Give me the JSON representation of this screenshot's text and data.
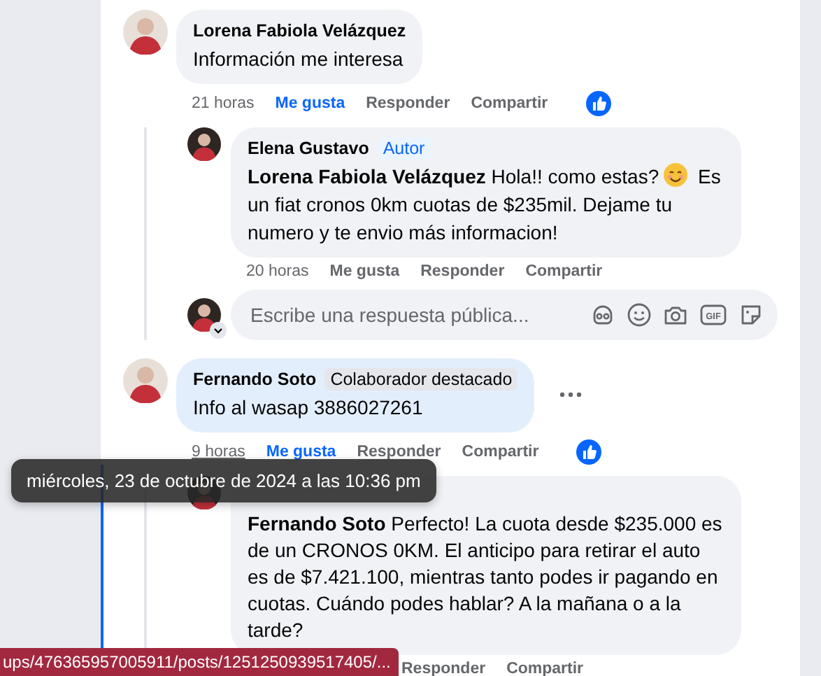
{
  "comments": [
    {
      "author": "Lorena Fabiola Velázquez",
      "highlighted": false,
      "segments": [
        {
          "kind": "text",
          "text": "Información me interesa"
        }
      ],
      "actions": [
        {
          "kind": "time",
          "label": "21 horas",
          "hovered": false
        },
        {
          "kind": "like",
          "label": "Me gusta",
          "selected": true
        },
        {
          "kind": "reply",
          "label": "Responder"
        },
        {
          "kind": "share",
          "label": "Compartir"
        }
      ],
      "reacted": true,
      "replies": [
        {
          "author": "Elena Gustavo",
          "badge": {
            "kind": "author",
            "label": "Autor"
          },
          "highlighted": false,
          "segments": [
            {
              "kind": "text",
              "text": "**Lorena Fabiola Velázquez** Hola!! como estas?"
            },
            {
              "kind": "emoji"
            },
            {
              "kind": "text",
              "text": "Es un fiat cronos 0km cuotas de $235mil. Dejame tu numero y te envio más informacion!"
            }
          ],
          "actions": [
            {
              "kind": "time",
              "label": "20 horas",
              "hovered": false
            },
            {
              "kind": "like",
              "label": "Me gusta",
              "selected": false
            },
            {
              "kind": "reply",
              "label": "Responder"
            },
            {
              "kind": "share",
              "label": "Compartir"
            }
          ]
        }
      ],
      "reply_box": {
        "placeholder": "Escribe una respuesta pública...",
        "gif_label": "GIF"
      }
    },
    {
      "author": "Fernando Soto",
      "badge": {
        "kind": "top_fan",
        "label": "Colaborador destacado"
      },
      "highlighted": true,
      "menu": true,
      "segments": [
        {
          "kind": "text",
          "text": "Info al wasap 3886027261"
        }
      ],
      "actions": [
        {
          "kind": "time",
          "label": "9 horas",
          "hovered": true
        },
        {
          "kind": "like",
          "label": "Me gusta",
          "selected": true
        },
        {
          "kind": "reply",
          "label": "Responder"
        },
        {
          "kind": "share",
          "label": "Compartir"
        }
      ],
      "reacted": true,
      "replies": [
        {
          "highlighted": false,
          "segments": [
            {
              "kind": "text",
              "text": "**Fernando Soto** Perfecto! La cuota desde $235.000 es de un CRONOS 0KM. El anticipo para retirar el auto es de $7.421.100, mientras tanto podes ir pagando en cuotas. Cuándo podes hablar? A la mañana o a la tarde?"
            }
          ],
          "actions": [
            {
              "kind": "reply",
              "label": "Responder"
            },
            {
              "kind": "share",
              "label": "Compartir"
            }
          ]
        }
      ]
    }
  ],
  "tooltip": "miércoles, 23 de octubre de 2024 a las 10:36 pm",
  "status_bar": "ups/476365957005911/posts/1251250939517405/..."
}
